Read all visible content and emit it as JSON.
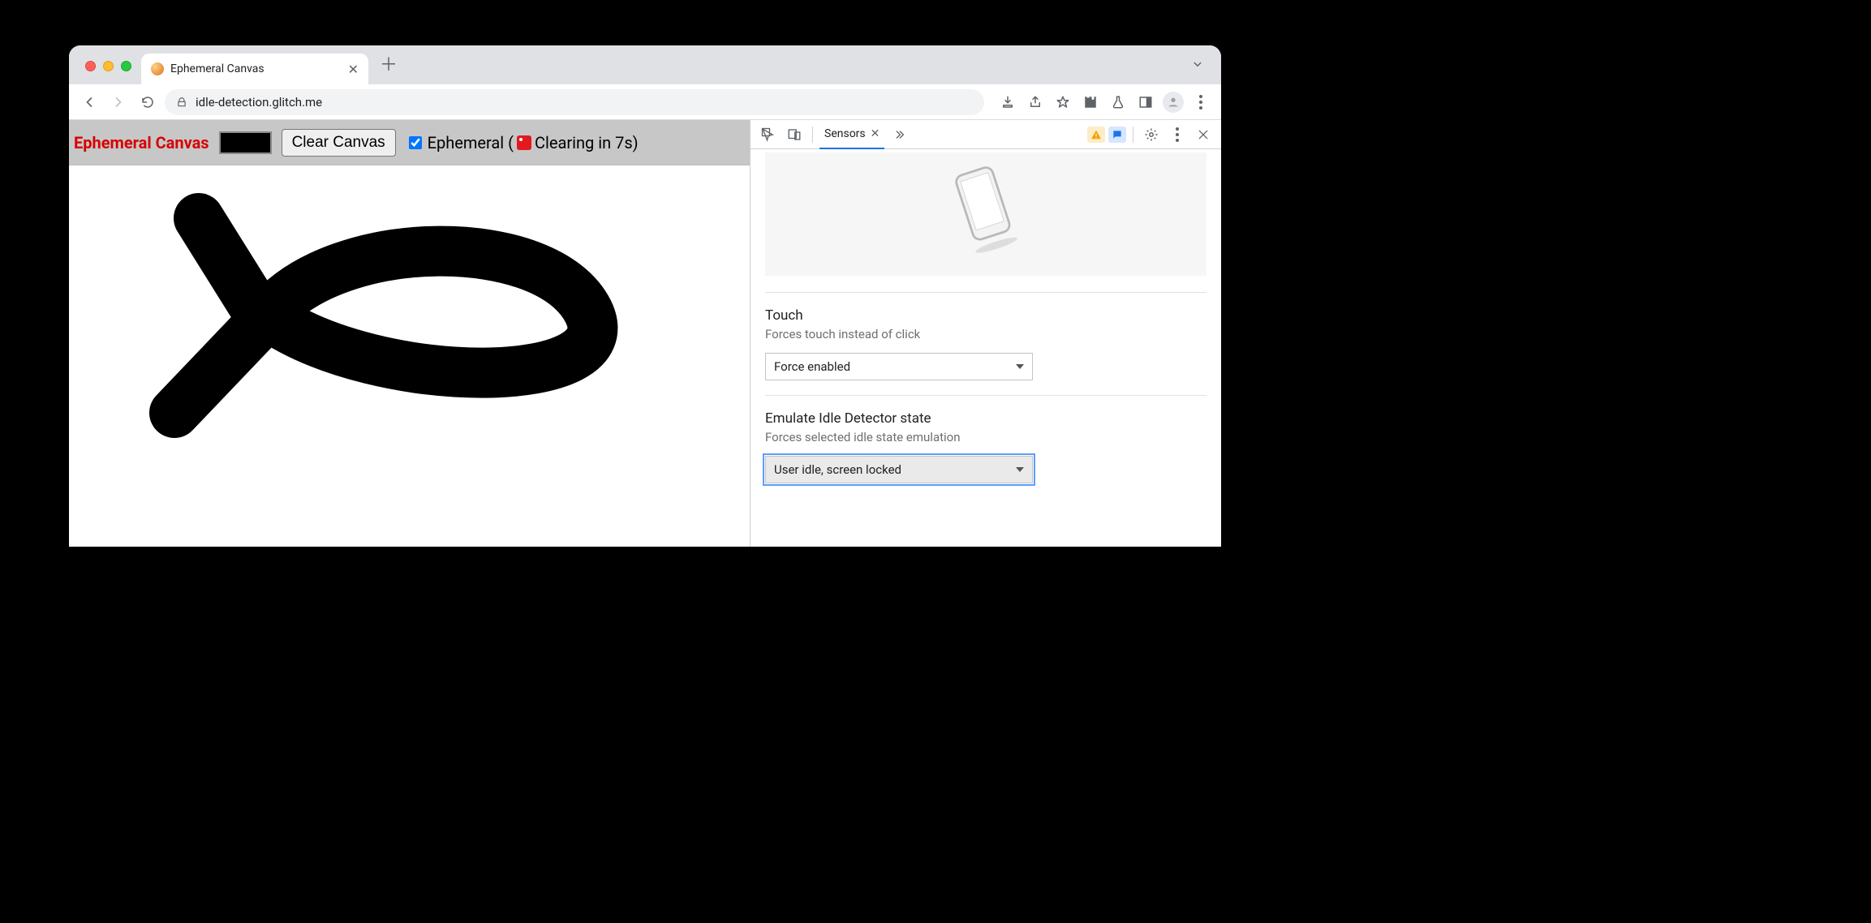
{
  "browser": {
    "tab_title": "Ephemeral Canvas",
    "url": "idle-detection.glitch.me"
  },
  "page": {
    "app_title": "Ephemeral Canvas",
    "clear_button": "Clear Canvas",
    "ephemeral_label_prefix": "Ephemeral (",
    "ephemeral_label_suffix": " Clearing in 7s)",
    "ephemeral_checked": true,
    "brush_color": "#000000"
  },
  "devtools": {
    "active_tab": "Sensors",
    "touch": {
      "title": "Touch",
      "subtitle": "Forces touch instead of click",
      "value": "Force enabled"
    },
    "idle": {
      "title": "Emulate Idle Detector state",
      "subtitle": "Forces selected idle state emulation",
      "value": "User idle, screen locked"
    }
  }
}
